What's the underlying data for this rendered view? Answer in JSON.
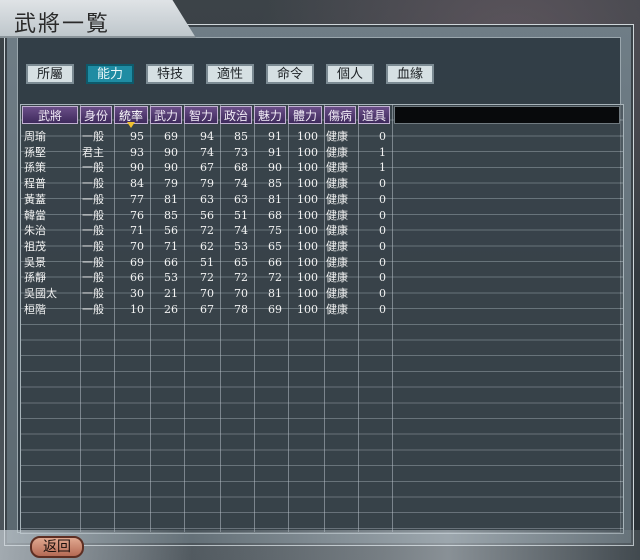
{
  "title": "武將一覧",
  "tabs": [
    {
      "label": "所屬",
      "active": false
    },
    {
      "label": "能力",
      "active": true
    },
    {
      "label": "特技",
      "active": false
    },
    {
      "label": "適性",
      "active": false
    },
    {
      "label": "命令",
      "active": false
    },
    {
      "label": "個人",
      "active": false
    },
    {
      "label": "血緣",
      "active": false
    }
  ],
  "columns": [
    "武將",
    "身份",
    "統率",
    "武力",
    "智力",
    "政治",
    "魅力",
    "體力",
    "傷病",
    "道具"
  ],
  "sorted_column": "統率",
  "rows": [
    [
      "周瑜",
      "一般",
      "95",
      "69",
      "94",
      "85",
      "91",
      "100",
      "健康",
      "0"
    ],
    [
      "孫堅",
      "君主",
      "93",
      "90",
      "74",
      "73",
      "91",
      "100",
      "健康",
      "1"
    ],
    [
      "孫策",
      "一般",
      "90",
      "90",
      "67",
      "68",
      "90",
      "100",
      "健康",
      "1"
    ],
    [
      "程普",
      "一般",
      "84",
      "79",
      "79",
      "74",
      "85",
      "100",
      "健康",
      "0"
    ],
    [
      "黃蓋",
      "一般",
      "77",
      "81",
      "63",
      "63",
      "81",
      "100",
      "健康",
      "0"
    ],
    [
      "韓當",
      "一般",
      "76",
      "85",
      "56",
      "51",
      "68",
      "100",
      "健康",
      "0"
    ],
    [
      "朱治",
      "一般",
      "71",
      "56",
      "72",
      "74",
      "75",
      "100",
      "健康",
      "0"
    ],
    [
      "祖茂",
      "一般",
      "70",
      "71",
      "62",
      "53",
      "65",
      "100",
      "健康",
      "0"
    ],
    [
      "吳景",
      "一般",
      "69",
      "66",
      "51",
      "65",
      "66",
      "100",
      "健康",
      "0"
    ],
    [
      "孫靜",
      "一般",
      "66",
      "53",
      "72",
      "72",
      "72",
      "100",
      "健康",
      "0"
    ],
    [
      "吳國太",
      "一般",
      "30",
      "21",
      "70",
      "70",
      "81",
      "100",
      "健康",
      "0"
    ],
    [
      "桓階",
      "一般",
      "10",
      "26",
      "67",
      "78",
      "69",
      "100",
      "健康",
      "0"
    ]
  ],
  "back_label": "返回",
  "colors": {
    "active_tab": "#1f8ca3",
    "header": "#4e3870",
    "back": "#c47a60"
  }
}
